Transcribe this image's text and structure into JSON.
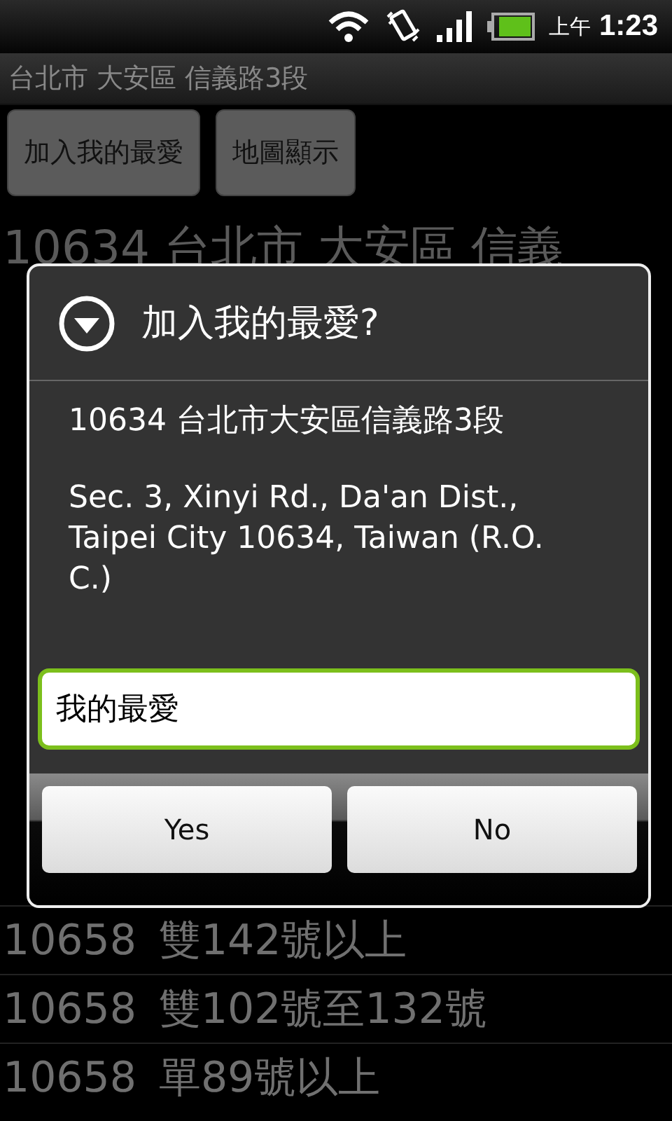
{
  "status_bar": {
    "ampm": "上午",
    "time": "1:23",
    "battery": {
      "level": 0.9
    }
  },
  "title_bar": {
    "title": "台北市 大安區 信義路3段"
  },
  "actions": [
    "加入我的最愛",
    "地圖顯示"
  ],
  "heading": "10634 台北市 大安區 信義",
  "rows": [
    {
      "code": "10658",
      "range": "雙142號以上"
    },
    {
      "code": "10658",
      "range": "雙102號至132號"
    },
    {
      "code": "10658",
      "range": "單89號以上"
    }
  ],
  "dialog": {
    "title": "加入我的最愛?",
    "chinese_address": "10634 台北市大安區信義路3段",
    "english_address": "Sec. 3, Xinyi Rd., Da'an Dist., Taipei City 10634, Taiwan (R.O. C.)",
    "input": {
      "value": "我的最愛"
    },
    "buttons": [
      "Yes",
      "No"
    ]
  }
}
